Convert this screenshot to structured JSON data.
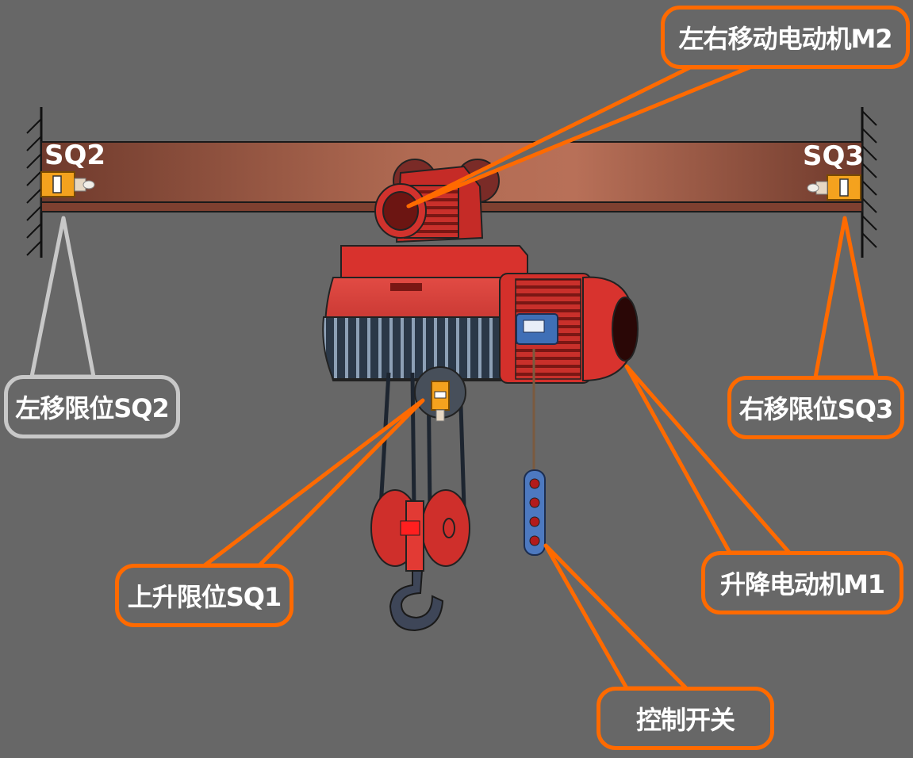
{
  "colors": {
    "background": "#676767",
    "callout_border": "#ff6a00",
    "callout_border_inactive": "#c8c8c8",
    "hoist_body": "#d9302c",
    "beam": "#a5614c"
  },
  "limit_labels": {
    "left": "SQ2",
    "right": "SQ3"
  },
  "callouts": {
    "motor_m2": "左右移动电动机M2",
    "left_limit": "左移限位SQ2",
    "right_limit": "右移限位SQ3",
    "up_limit": "上升限位SQ1",
    "motor_m1": "升降电动机M1",
    "control_switch": "控制开关"
  }
}
